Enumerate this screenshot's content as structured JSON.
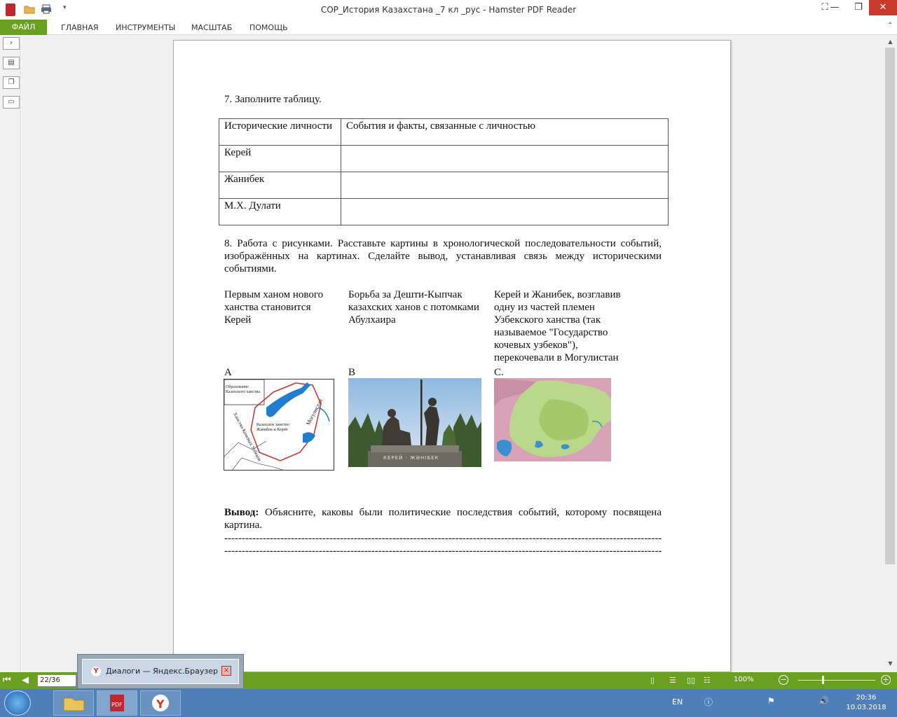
{
  "window": {
    "title": "СОР_История Казахстана _7 кл _рус - Hamster PDF Reader",
    "minimize": "—",
    "restore": "❐",
    "close": "✕"
  },
  "ribbon": {
    "tabs": [
      "ФАЙЛ",
      "ГЛАВНАЯ",
      "ИНСТРУМЕНТЫ",
      "МАСШТАБ",
      "ПОМОЩЬ"
    ]
  },
  "doc": {
    "q7": "7. Заполните таблицу.",
    "table": {
      "headers": [
        "Исторические личности",
        "События и факты, связанные с личностью"
      ],
      "rows": [
        [
          "Керей",
          ""
        ],
        [
          "Жанибек",
          ""
        ],
        [
          "М.Х. Дулати",
          ""
        ]
      ]
    },
    "q8": "8. Работа с рисунками. Расставьте картины в хронологической последовательности событий, изображённых на картинах. Сделайте вывод, устанавливая связь между историческими событиями.",
    "captions": [
      "Первым ханом нового ханства становится Керей",
      "Борьба за Дешти-Кыпчак казахских ханов с потомками Абулхаира",
      "Керей и Жанибек, возглавив одну из частей племен Узбекского ханства (так называемое \"Государство кочевых узбеков\"), перекочевали в Могулистан"
    ],
    "labels": [
      "А",
      "В",
      "С."
    ],
    "map_texts": {
      "formation": "Образование Казахского ханства",
      "khanate": "Казахское ханство Жанибек и Керей",
      "uzbek": "Ханство Кочевых Узбеков",
      "mogul": "Могулистан"
    },
    "monument_text": "КЕРЕЙ · ЖӘНІБЕК",
    "conclusion_bold": "Вывод:",
    "conclusion_text": " Объясните, каковы были политические последствия событий, которому посвящена картина.",
    "dashes": "-----------------------------------------------------------------------------------------------------------------------------------------"
  },
  "status": {
    "page": "22/36",
    "zoom": "100%"
  },
  "popup": {
    "label": "Диалоги — Яндекс.Браузер"
  },
  "taskbar": {
    "lang": "EN",
    "time": "20:36",
    "date": "10.03.2018"
  },
  "colors": {
    "accent": "#6aa020",
    "taskbar": "#4f7fb9",
    "close": "#c7392a"
  }
}
